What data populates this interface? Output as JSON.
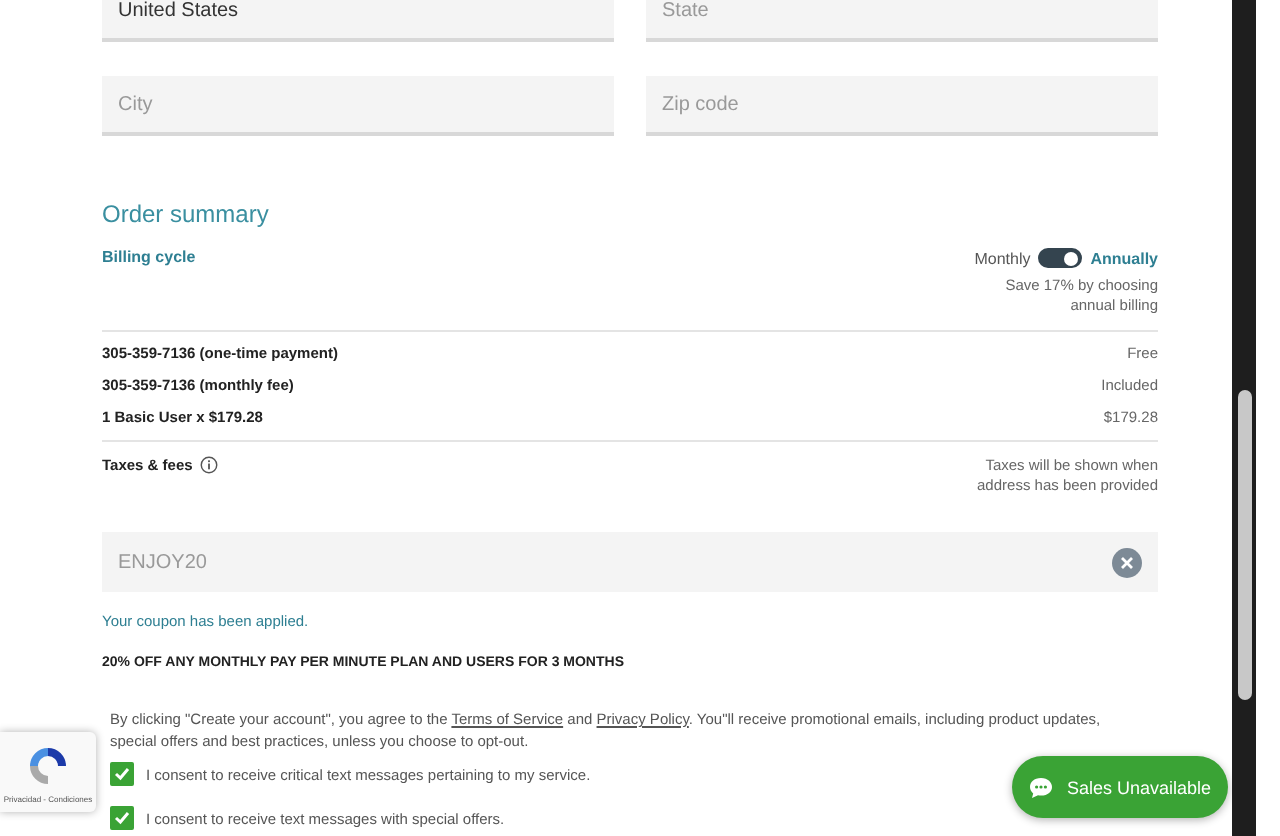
{
  "address_fields": [
    {
      "value": "United States"
    },
    {
      "placeholder": "State"
    },
    {
      "placeholder": "City"
    },
    {
      "placeholder": "Zip code"
    }
  ],
  "order_summary": {
    "title": "Order summary",
    "billing_label": "Billing cycle",
    "monthly_label": "Monthly",
    "annual_label": "Annually",
    "annual": true,
    "savings_note": [
      "Save 17% by choosing",
      "annual billing"
    ]
  },
  "line_items": [
    {
      "label": "305-359-7136 (one-time payment)",
      "value": "Free"
    },
    {
      "label": "305-359-7136 (monthly fee)",
      "value": "Included"
    },
    {
      "label": "1 Basic User x $179.28",
      "value": "$179.28"
    }
  ],
  "taxes": {
    "label": "Taxes & fees",
    "note": [
      "Taxes will be shown when",
      "address has been provided"
    ]
  },
  "coupon": {
    "value": "ENJOY20",
    "message": "Your coupon has been applied.",
    "promo": "20% OFF ANY MONTHLY PAY PER MINUTE PLAN AND USERS FOR 3 MONTHS"
  },
  "terms": {
    "before": "By clicking \"Create your account\", you agree to the",
    "terms_link": "Terms of Service",
    "and": "and",
    "privacy_link": "Privacy Policy",
    "after": ". You\"ll receive promotional emails, including product updates, special offers and best practices, unless you choose to opt-out."
  },
  "consents": [
    {
      "label": "I consent to receive critical text messages pertaining to my service.",
      "checked": true
    },
    {
      "label": "I consent to receive text messages with special offers.",
      "checked": true
    }
  ],
  "recaptcha": {
    "footer": "Privacidad - Condiciones"
  },
  "chat_button": {
    "label": "Sales Unavailable"
  }
}
